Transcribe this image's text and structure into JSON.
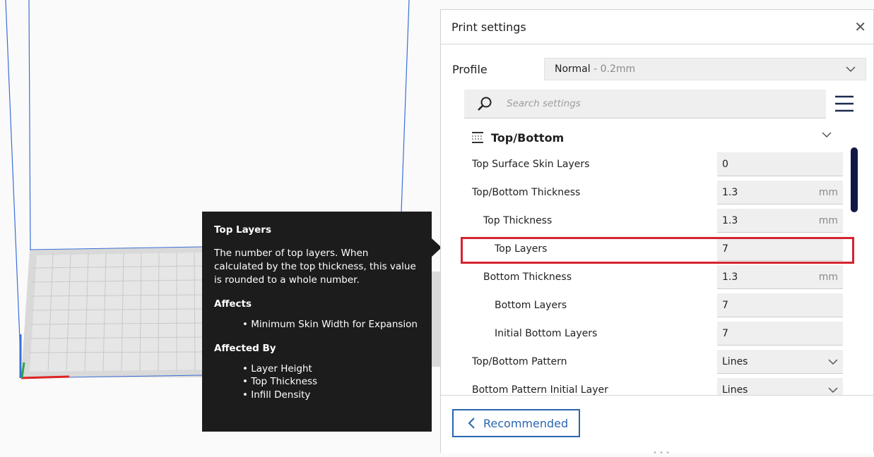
{
  "panel": {
    "title": "Print settings",
    "profile_label": "Profile",
    "profile_value": "Normal",
    "profile_sub": " - 0.2mm",
    "search_placeholder": "Search settings",
    "category": "Top/Bottom",
    "settings": [
      {
        "name": "Top Surface Skin Layers",
        "value": "0",
        "unit": ""
      },
      {
        "name": "Top/Bottom Thickness",
        "value": "1.3",
        "unit": "mm"
      },
      {
        "name": "Top Thickness",
        "value": "1.3",
        "unit": "mm"
      },
      {
        "name": "Top Layers",
        "value": "7",
        "unit": ""
      },
      {
        "name": "Bottom Thickness",
        "value": "1.3",
        "unit": "mm"
      },
      {
        "name": "Bottom Layers",
        "value": "7",
        "unit": ""
      },
      {
        "name": "Initial Bottom Layers",
        "value": "7",
        "unit": ""
      },
      {
        "name": "Top/Bottom Pattern",
        "value": "Lines",
        "unit": ""
      },
      {
        "name": "Bottom Pattern Initial Layer",
        "value": "Lines",
        "unit": ""
      }
    ],
    "recommended_label": "Recommended"
  },
  "tooltip": {
    "title": "Top Layers",
    "description": "The number of top layers. When calculated by the top thickness, this value is rounded to a whole number.",
    "affects_label": "Affects",
    "affects": [
      "Minimum Skin Width for Expansion"
    ],
    "affected_by_label": "Affected By",
    "affected_by": [
      "Layer Height",
      "Top Thickness",
      "Infill Density"
    ]
  },
  "colors": {
    "highlight": "#d52330",
    "accent": "#2a66b0",
    "tooltip_bg": "#1c1c1c",
    "scrollbar": "#101844"
  }
}
